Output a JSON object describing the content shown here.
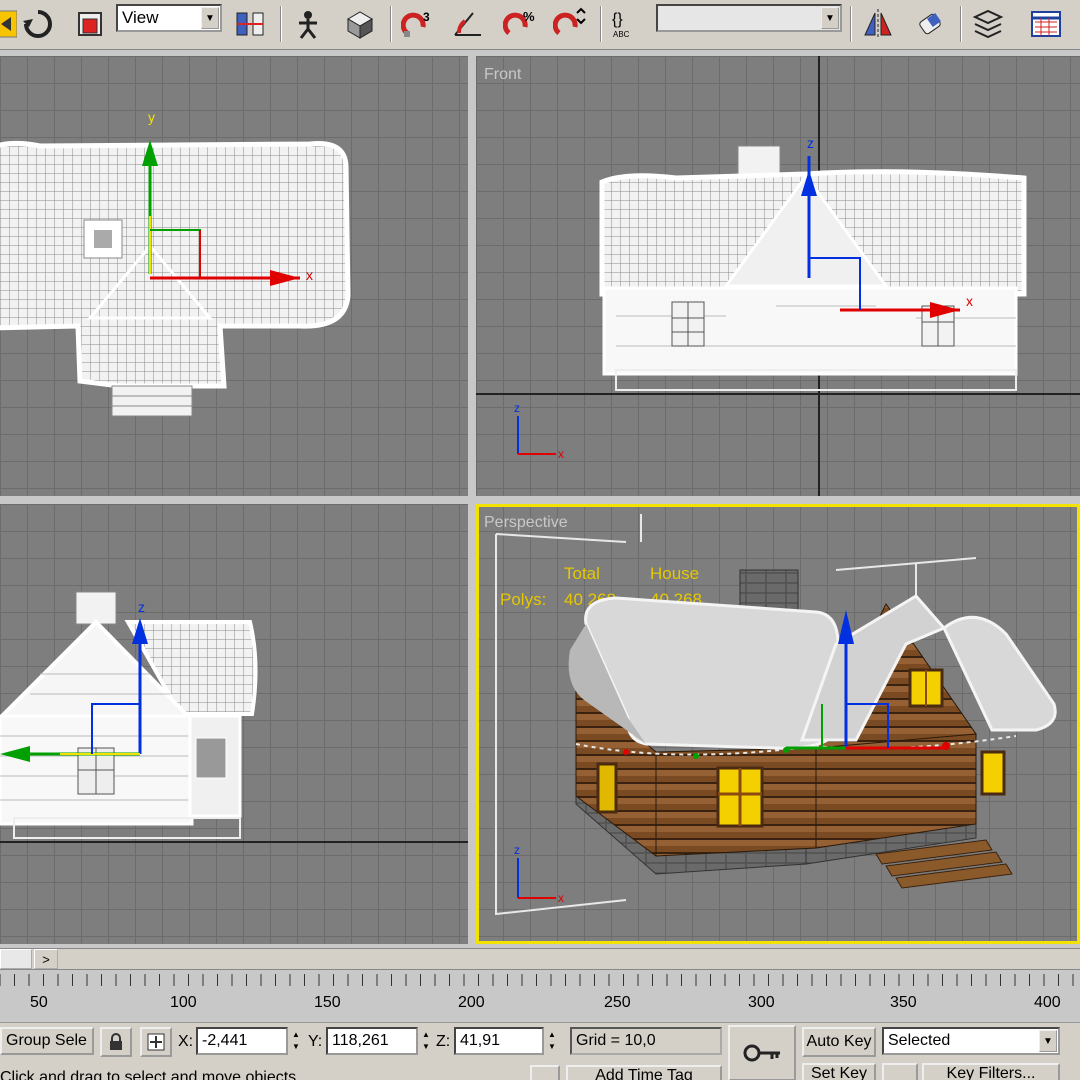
{
  "toolbar": {
    "reference_coord_value": "View",
    "named_selection_value": "",
    "icons": [
      "select-move-icon",
      "rotate-icon",
      "scale-icon",
      "reference-coord-combo",
      "pivot-center-icon",
      "select-manipulate-icon",
      "keyboard-shortcut-icon",
      "snaps-3-icon",
      "angle-snap-icon",
      "percent-snap-icon",
      "spinner-snap-icon",
      "edit-named-selections-icon",
      "named-selection-combo",
      "mirror-icon",
      "align-icon",
      "layer-manager-icon",
      "curve-editor-icon"
    ],
    "snap_label": "3",
    "percent_label": "%",
    "abc_label": "ABC"
  },
  "viewports": {
    "top": {
      "label": ""
    },
    "front": {
      "label": "Front",
      "axes": {
        "z": "z",
        "x": "x"
      }
    },
    "left": {
      "label": ""
    },
    "perspective": {
      "label": "Perspective",
      "stats": {
        "col1_header": "Total",
        "col2_header": "House",
        "row_label": "Polys:",
        "total": "40 268",
        "house": "40 268"
      }
    },
    "gizmo": {
      "y": "y",
      "x": "x",
      "z": "z"
    }
  },
  "timeline": {
    "next_label": ">",
    "ticks": [
      "50",
      "100",
      "150",
      "200",
      "250",
      "300",
      "350",
      "400"
    ]
  },
  "statusbar": {
    "selection_mode": "Group Sele",
    "x_label": "X:",
    "x_value": "-2,441",
    "y_label": "Y:",
    "y_value": "118,261",
    "z_label": "Z:",
    "z_value": "41,91",
    "grid": "Grid = 10,0",
    "prompt": "Click and drag to select and move objects",
    "add_time_tag": "Add Time Tag",
    "auto_key": "Auto Key",
    "set_key": "Set Key",
    "key_mode_value": "Selected",
    "key_filters": "Key Filters..."
  },
  "colors": {
    "active_viewport": "#f2e200",
    "stat_text": "#e6c800",
    "viewport_bg": "#7e7e7e",
    "axis_x": "#e00000",
    "axis_y": "#00a000",
    "axis_z": "#0030e0"
  }
}
